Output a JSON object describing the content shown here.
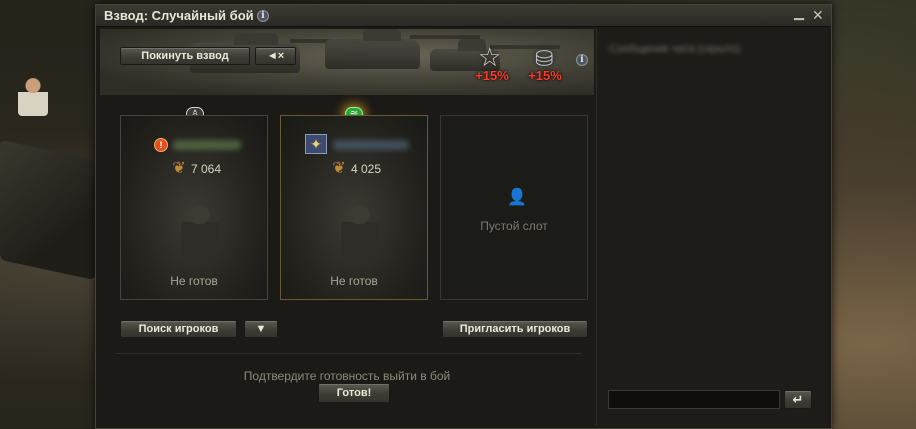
{
  "window": {
    "title": "Взвод: Случайный бой",
    "info_icon": "i"
  },
  "header": {
    "leave_label": "Покинуть взвод",
    "mute_icon": "◄×",
    "bonuses": [
      {
        "icon": "star-icon",
        "text": "+15%"
      },
      {
        "icon": "silver-coins-icon",
        "text": "+15%"
      }
    ]
  },
  "slots": [
    {
      "indicator": "♙",
      "badge": "!",
      "rating": "7 064",
      "status": "Не готов"
    },
    {
      "indicator": "≋",
      "badge": "✦",
      "rating": "4 025",
      "status": "Не готов"
    },
    {
      "empty_label": "Пустой слот"
    }
  ],
  "actions": {
    "search_label": "Поиск игроков",
    "filter_icon": "▼",
    "invite_label": "Пригласить игроков"
  },
  "footer": {
    "confirm_text": "Подтвердите готовность выйти в бой",
    "ready_label": "Готов!"
  },
  "chat": {
    "message": "Сообщение чата (скрыто)",
    "send_icon": "↵"
  }
}
